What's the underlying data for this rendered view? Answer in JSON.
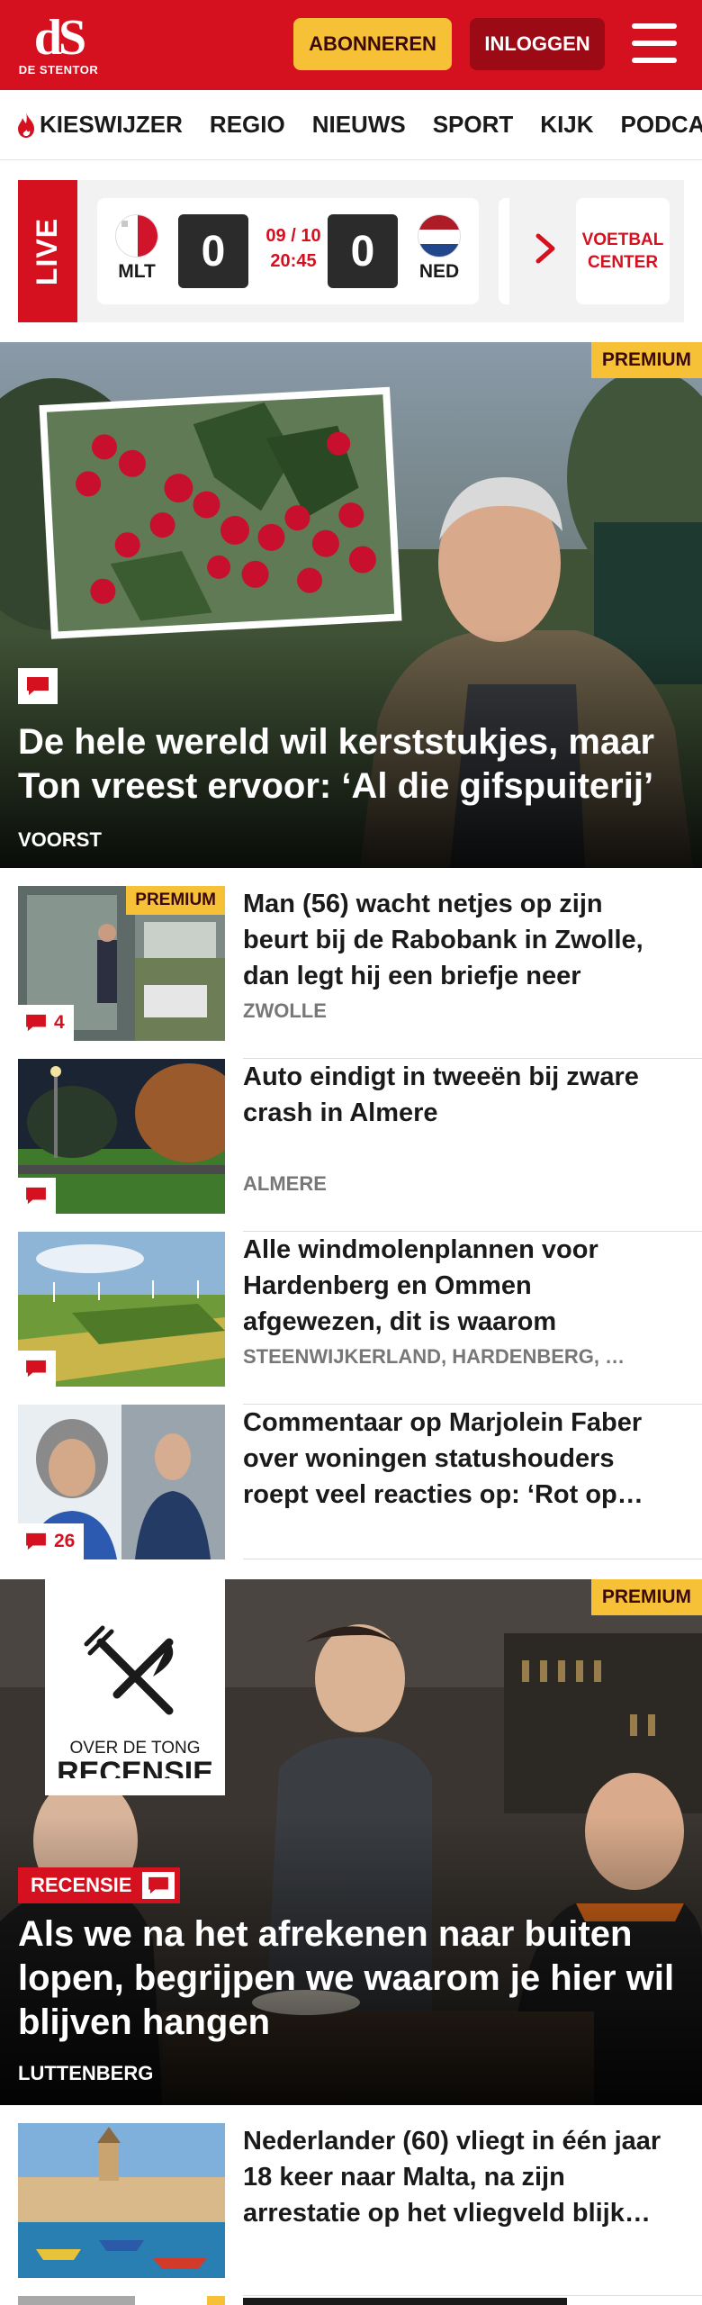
{
  "header": {
    "logo_mark": "dS",
    "logo_sub": "DE STENTOR",
    "subscribe_label": "ABONNEREN",
    "login_label": "INLOGGEN",
    "brand_color": "#d5101f",
    "accent_color": "#f6c137"
  },
  "nav": {
    "items": [
      "KIESWIJZER",
      "REGIO",
      "NIEUWS",
      "SPORT",
      "KIJK",
      "PODCAS"
    ]
  },
  "live": {
    "label": "LIVE",
    "home_code": "MLT",
    "away_code": "NED",
    "home_score": "0",
    "away_score": "0",
    "date": "09 / 10",
    "time": "20:45",
    "voetbal_center_label": "VOETBAL CENTER"
  },
  "hero1": {
    "premium": "PREMIUM",
    "title": "De hele wereld wil kerststukjes, maar Ton vreest ervoor: ‘Al die gifspuiterij’",
    "location": "VOORST"
  },
  "articles": [
    {
      "title": "Man (56) wacht netjes op zijn beurt bij de Rabobank in Zwolle, dan legt hij een briefje neer",
      "location": "ZWOLLE",
      "comments": "4",
      "premium": "PREMIUM"
    },
    {
      "title": "Auto eindigt in tweeën bij zware crash in Almere",
      "location": "ALMERE",
      "comments": ""
    },
    {
      "title": "Alle windmolenplannen voor Hardenberg en Ommen afgewezen, dit is waarom",
      "location": "STEENWIJKERLAND, HARDENBERG, …",
      "comments": ""
    },
    {
      "title": "Commentaar op Marjolein Faber over woningen statushouders roept veel reacties op: ‘Rot op…",
      "location": "",
      "comments": "26"
    }
  ],
  "hero2": {
    "premium": "PREMIUM",
    "badge_line1": "OVER DE TONG",
    "badge_line2": "RECENSIE",
    "tag": "RECENSIE",
    "title": "Als we na het afrekenen naar buiten lopen, begrijpen we waarom je hier wil blijven hangen",
    "location": "LUTTENBERG"
  },
  "article5": {
    "title": "Nederlander (60) vliegt in één jaar 18 keer naar Malta, na zijn arrestatie op het vliegveld blijk…"
  },
  "article6": {
    "premium": "PREMIUM"
  }
}
